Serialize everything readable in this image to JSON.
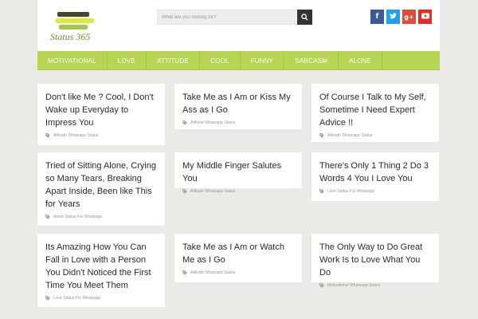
{
  "header": {
    "logo_text": "Status 365",
    "search_placeholder": "What are you looking for?",
    "social": [
      {
        "name": "facebook-icon",
        "glyph": "f",
        "color": "#3b5998"
      },
      {
        "name": "twitter-icon",
        "glyph": "t",
        "color": "#1da1f2"
      },
      {
        "name": "google-plus-icon",
        "glyph": "g+",
        "color": "#dd4b39"
      },
      {
        "name": "youtube-icon",
        "glyph": "▶",
        "color": "#e52d27"
      }
    ]
  },
  "nav": {
    "items": [
      "MOTIVATIONAL",
      "LOVE",
      "ATTITUDE",
      "COOL",
      "FUNNY",
      "SARCASM",
      "ALONE"
    ]
  },
  "posts": [
    {
      "title": "Don't like Me ? Cool, I Don't Wake up Everyday to Impress You",
      "category": "Attitude Whatsapp Status"
    },
    {
      "title": "Take Me as I Am or Kiss My Ass as I Go",
      "category": "Attitude Whatsapp Status"
    },
    {
      "title": "Of Course I Talk to My Self, Sometime I Need Expert Advice !!",
      "category": "Attitude Whatsapp Status"
    },
    {
      "title": "Tried of Sitting Alone, Crying so Many Tears, Breaking Apart Inside, Been like This for Years",
      "category": "Alone Status For Whatsapp"
    },
    {
      "title": "My Middle Finger Salutes You",
      "category": "Attitude Whatsapp Status"
    },
    {
      "title": "There's Only 1 Thing 2 Do 3 Words 4 You I Love You",
      "category": "Love Status For Whatsapp"
    },
    {
      "title": "Its Amazing How You Can Fall in Love with a Person You Didn't Noticed the First Time You Meet Them",
      "category": "Love Status For Whatsapp"
    },
    {
      "title": "Take Me as I Am or Watch Me as I Go",
      "category": "Attitude Whatsapp Status"
    },
    {
      "title": "The Only Way to Do Great Work Is to Love What You Do",
      "category": "Motivational Whatsapp Status"
    }
  ],
  "colors": {
    "accent": "#b5d553",
    "background": "#eceae6",
    "logo_bar_1": "#3f4a2a",
    "logo_bar_2": "#dcea3c",
    "logo_bar_3": "#a6c84a"
  }
}
